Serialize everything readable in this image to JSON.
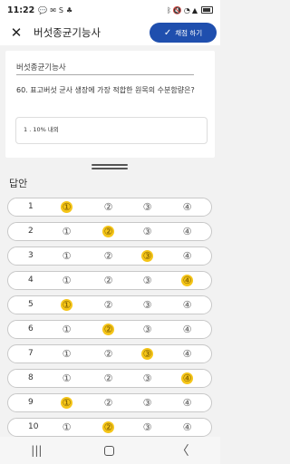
{
  "status_bar": {
    "time": "11:22",
    "left_icons": [
      "chat-icon",
      "text-icon",
      "s-icon",
      "app-icon"
    ],
    "right_icons": [
      "bluetooth-icon",
      "mute-icon",
      "wifi-icon",
      "signal-icon",
      "battery-icon"
    ]
  },
  "app_bar": {
    "title": "버섯종균기능사",
    "submit_label": "채점 하기"
  },
  "question": {
    "subject": "버섯종균기능사",
    "text": "60. 표고버섯 균사 생장에 가장 적합한 원목의 수분함량은?",
    "answer_text": "1 . 10% 내외"
  },
  "answers": {
    "label": "답안",
    "options": [
      "①",
      "②",
      "③",
      "④"
    ],
    "rows": [
      {
        "number": "1",
        "selected": 1
      },
      {
        "number": "2",
        "selected": 2
      },
      {
        "number": "3",
        "selected": 3
      },
      {
        "number": "4",
        "selected": 4
      },
      {
        "number": "5",
        "selected": 1
      },
      {
        "number": "6",
        "selected": 2
      },
      {
        "number": "7",
        "selected": 3
      },
      {
        "number": "8",
        "selected": 4
      },
      {
        "number": "9",
        "selected": 1
      },
      {
        "number": "10",
        "selected": 2
      }
    ]
  },
  "nav_bar": {
    "items": [
      "recents-button",
      "home-button",
      "back-button"
    ]
  },
  "colors": {
    "accent": "#1f4fae",
    "selected_option": "#f5c518"
  }
}
